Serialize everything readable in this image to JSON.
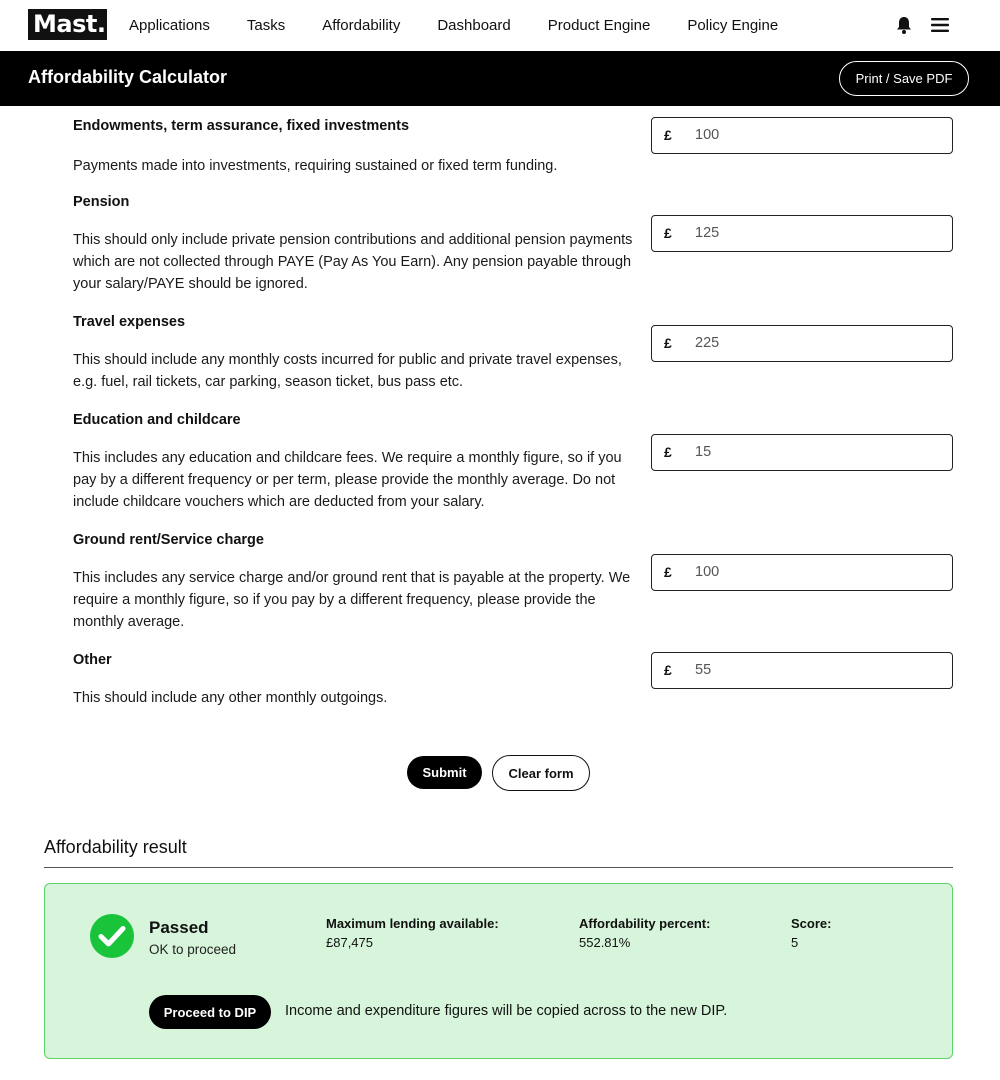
{
  "nav": {
    "logo": "Mast.",
    "links": [
      "Applications",
      "Tasks",
      "Affordability",
      "Dashboard",
      "Product Engine",
      "Policy Engine"
    ],
    "icons": [
      "bell-icon",
      "hamburger-menu-icon"
    ]
  },
  "header": {
    "title": "Affordability Calculator",
    "print_label": "Print / Save PDF"
  },
  "fields": [
    {
      "title": "Endowments, term assurance, fixed investments",
      "description": "Payments made into investments, requiring sustained or fixed term funding.",
      "currency": "£",
      "value": "100"
    },
    {
      "title": "Pension",
      "description": "This should only include private pension contributions and additional pension payments which are not collected through PAYE (Pay As You Earn). Any pension payable through your salary/PAYE should be ignored.",
      "currency": "£",
      "value": "125"
    },
    {
      "title": "Travel expenses",
      "description": "This should include any monthly costs incurred for public and private travel expenses, e.g. fuel, rail tickets, car parking, season ticket, bus pass etc.",
      "currency": "£",
      "value": "225"
    },
    {
      "title": "Education and childcare",
      "description": "This includes any education and childcare fees. We require a monthly figure, so if you pay by a different frequency or per term, please provide the monthly average. Do not include childcare vouchers which are deducted from your salary.",
      "currency": "£",
      "value": "15"
    },
    {
      "title": "Ground rent/Service charge",
      "description": "This includes any service charge and/or ground rent that is payable at the property. We require a monthly figure, so if you pay by a different frequency, please provide the monthly average.",
      "currency": "£",
      "value": "100"
    },
    {
      "title": "Other",
      "description": "This should include any other monthly outgoings.",
      "currency": "£",
      "value": "55"
    }
  ],
  "actions": {
    "submit_label": "Submit",
    "clear_label": "Clear form"
  },
  "result": {
    "heading": "Affordability result",
    "status": "Passed",
    "status_sub": "OK to proceed",
    "max_lending_label": "Maximum lending available:",
    "max_lending_value": "£87,475",
    "afford_percent_label": "Affordability percent:",
    "afford_percent_value": "552.81%",
    "score_label": "Score:",
    "score_value": "5",
    "dip_label": "Proceed to DIP",
    "dip_note": "Income and expenditure figures will be copied across to the new DIP.",
    "colors": {
      "card_bg": "#d7f5db",
      "card_border": "#5fd36b",
      "check": "#19c43a"
    }
  }
}
